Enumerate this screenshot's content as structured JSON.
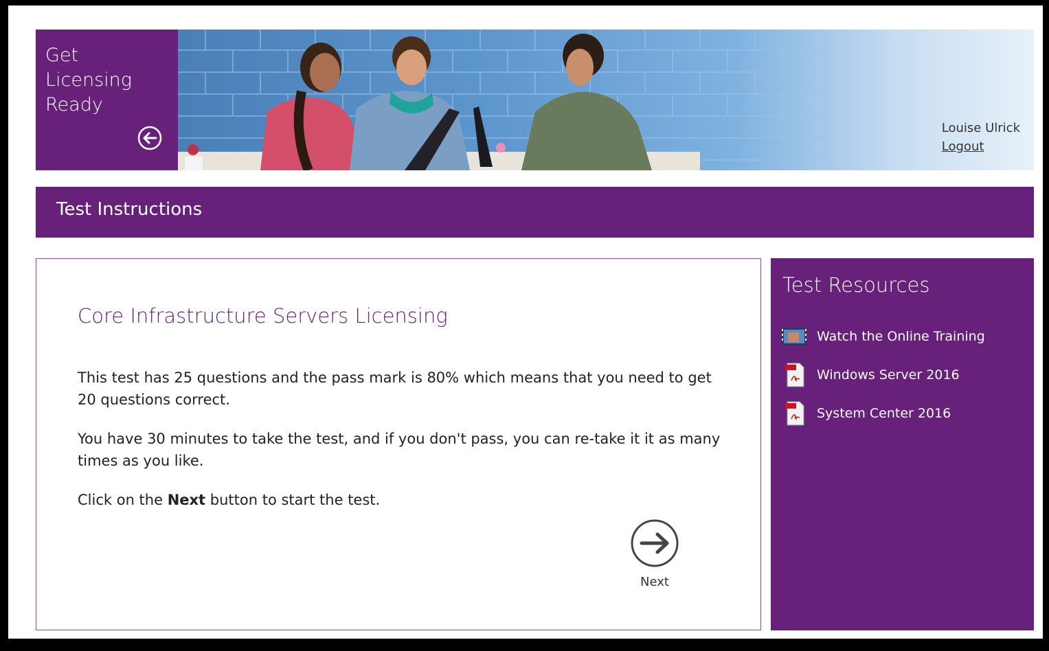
{
  "brand": {
    "title_lines": [
      "Get",
      "Licensing",
      "Ready"
    ]
  },
  "user": {
    "name": "Louise Ulrick",
    "logout_label": "Logout"
  },
  "page_title": "Test Instructions",
  "main": {
    "course_title": "Core Infrastructure Servers Licensing",
    "paragraph1": "This test has 25 questions and the pass mark is 80% which means that you need to get 20 questions correct.",
    "paragraph2": "You have 30 minutes to take the test, and if you don't pass, you can re-take it it as many times as you like.",
    "paragraph3_prefix": "Click on the ",
    "paragraph3_bold": "Next",
    "paragraph3_suffix": " button to start the test.",
    "next_label": "Next"
  },
  "resources": {
    "title": "Test Resources",
    "items": [
      {
        "label": "Watch the Online Training",
        "icon": "video-icon"
      },
      {
        "label": "Windows Server 2016",
        "icon": "pdf-icon"
      },
      {
        "label": "System Center 2016",
        "icon": "pdf-icon"
      }
    ]
  },
  "colors": {
    "brand_purple": "#68217a",
    "panel_border": "#b43fb4",
    "background": "#000000"
  }
}
